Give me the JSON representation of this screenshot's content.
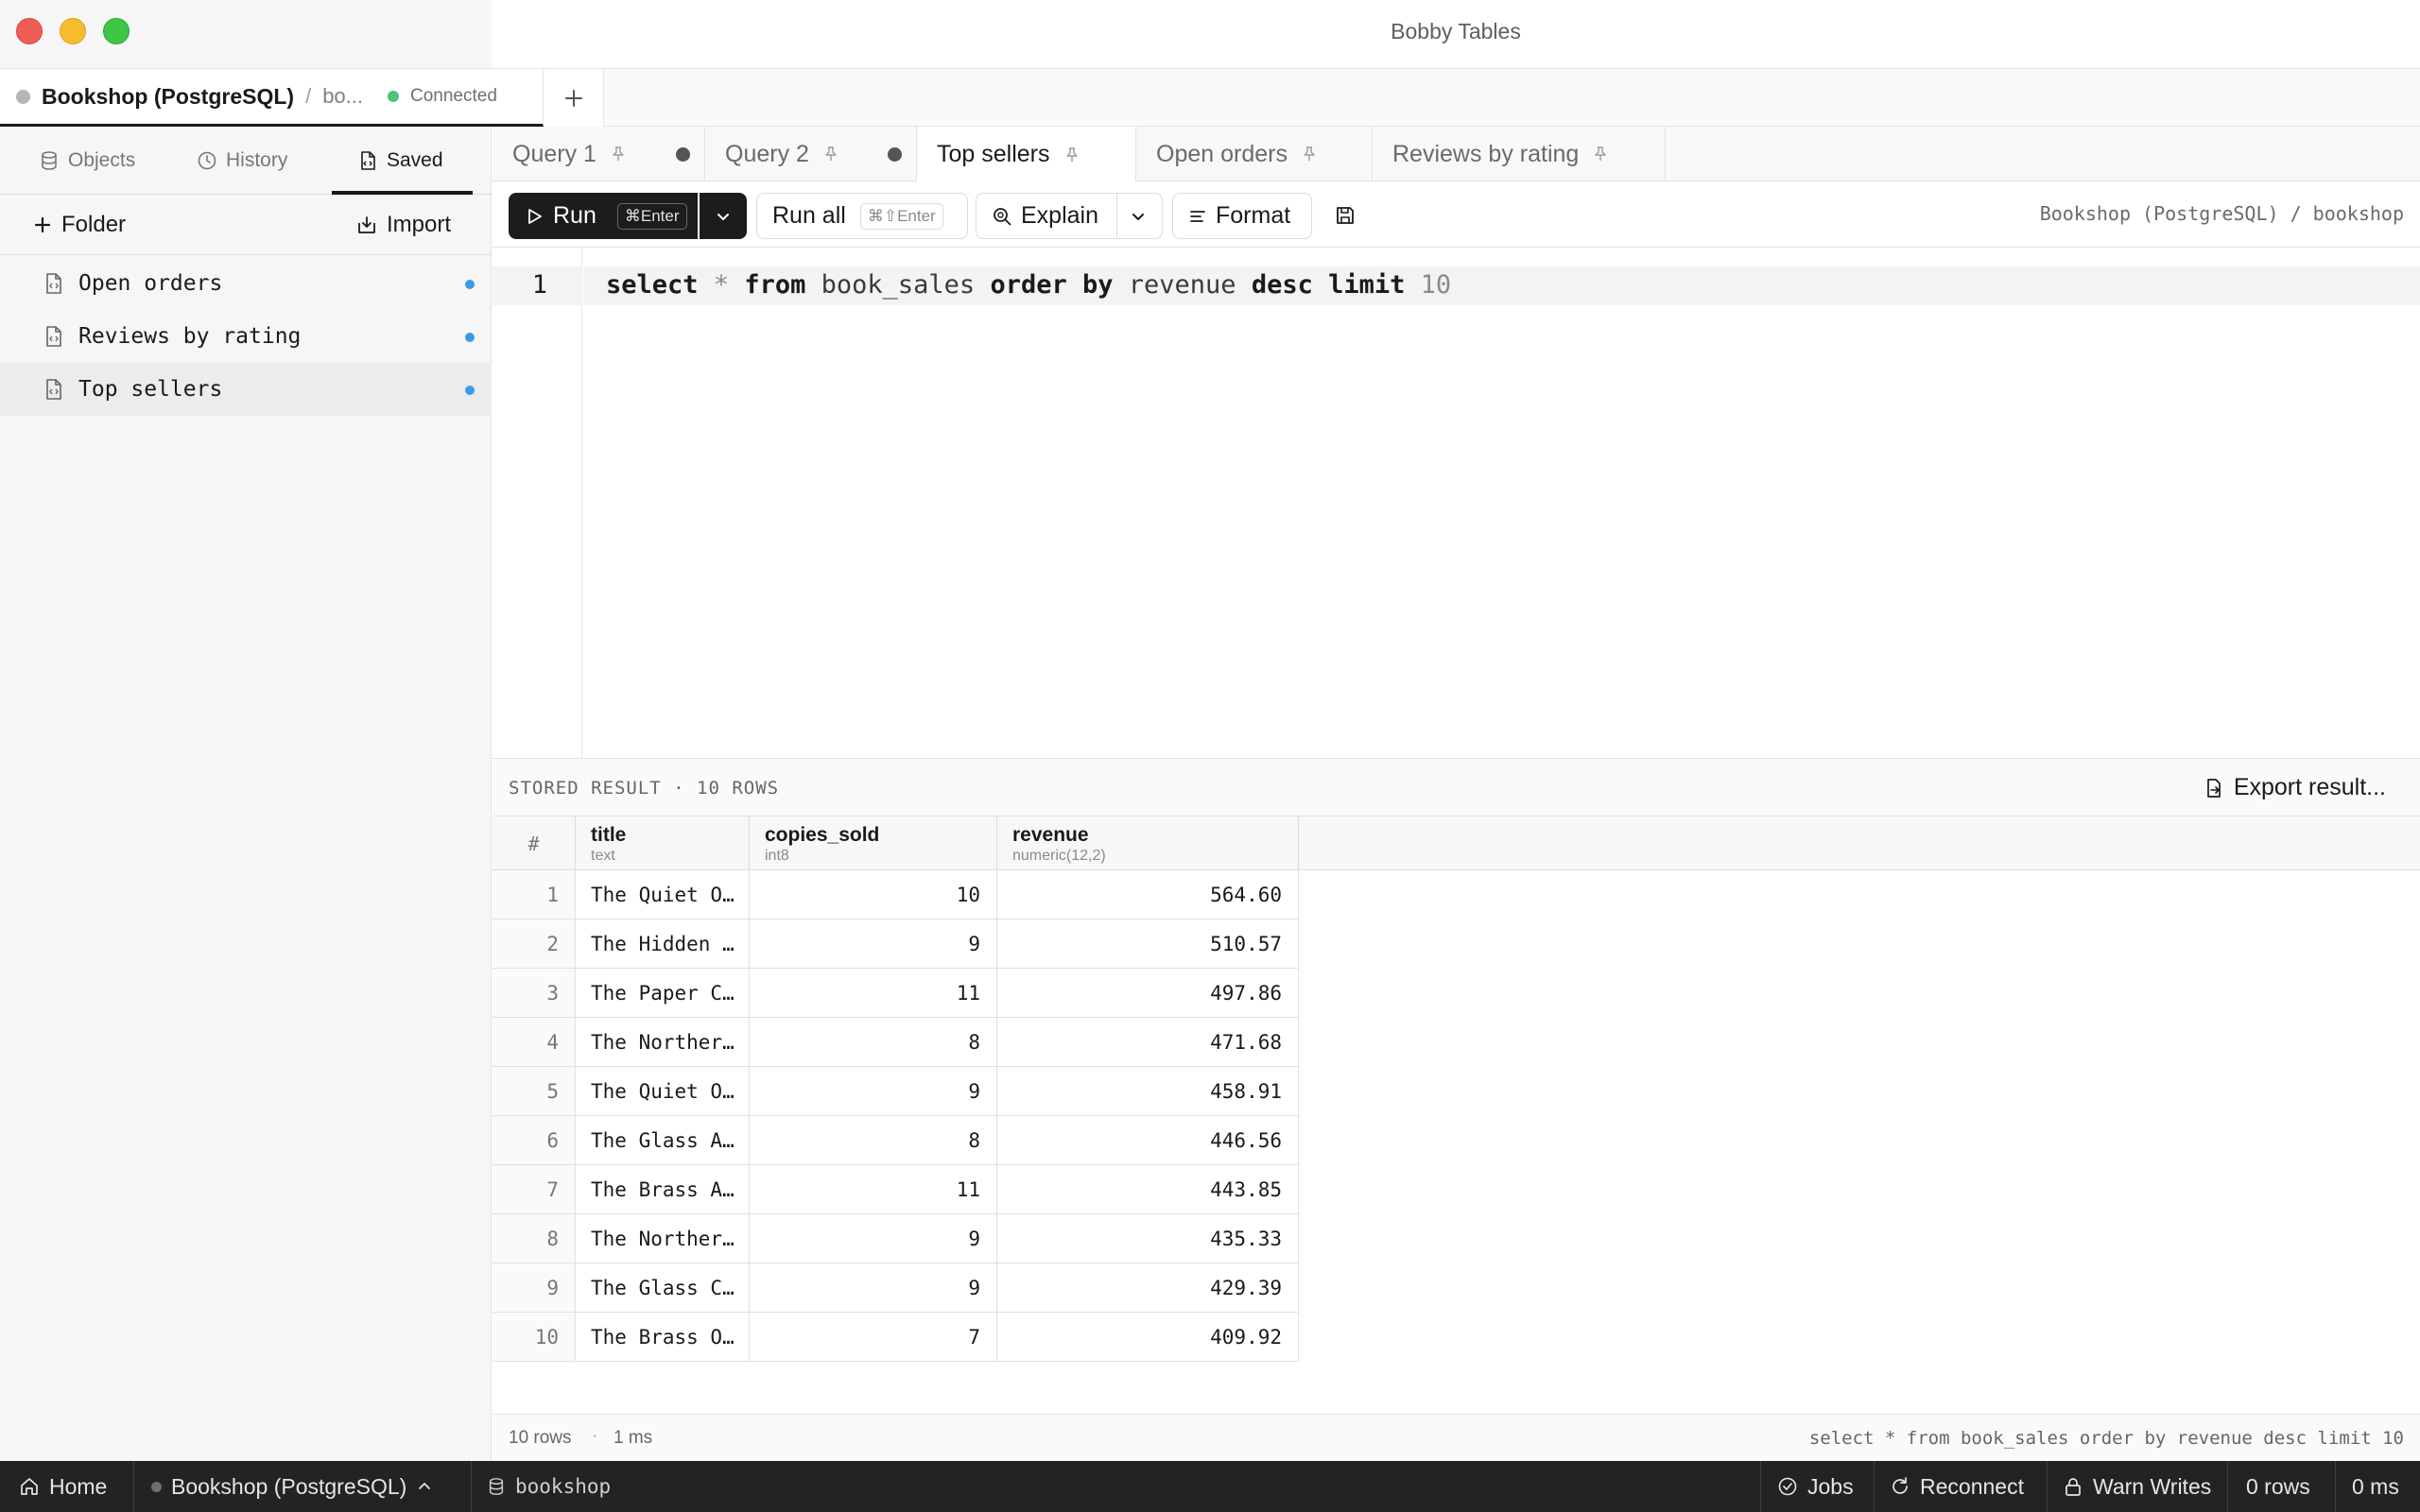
{
  "window": {
    "title": "Bobby Tables"
  },
  "connection_tab": {
    "name": "Bookshop (PostgreSQL)",
    "separator": "/",
    "database": "bo...",
    "status": "Connected"
  },
  "sidebar": {
    "tabs": [
      {
        "label": "Objects",
        "icon": "database-icon"
      },
      {
        "label": "History",
        "icon": "clock-icon"
      },
      {
        "label": "Saved",
        "icon": "saved-file-icon",
        "active": true
      }
    ],
    "folder_label": "Folder",
    "import_label": "Import",
    "saved_items": [
      {
        "label": "Open orders"
      },
      {
        "label": "Reviews by rating"
      },
      {
        "label": "Top sellers",
        "selected": true
      }
    ]
  },
  "query_tabs": [
    {
      "label": "Query 1",
      "dirty": true
    },
    {
      "label": "Query 2",
      "dirty": true
    },
    {
      "label": "Top sellers",
      "active": true
    },
    {
      "label": "Open orders"
    },
    {
      "label": "Reviews by rating"
    }
  ],
  "toolbar": {
    "run_label": "Run",
    "run_shortcut": "⌘Enter",
    "run_all_label": "Run all",
    "run_all_shortcut": "⌘⇧Enter",
    "explain_label": "Explain",
    "format_label": "Format",
    "path": "Bookshop (PostgreSQL) / bookshop"
  },
  "editor": {
    "line_number": "1",
    "tokens": [
      "select",
      " ",
      "*",
      " ",
      "from",
      " book_sales ",
      "order",
      " ",
      "by",
      " revenue ",
      "desc",
      " ",
      "limit",
      " ",
      "10"
    ]
  },
  "result": {
    "title": "STORED RESULT · 10 ROWS",
    "export_label": "Export result...",
    "row_number_header": "#",
    "columns": [
      {
        "name": "title",
        "type": "text"
      },
      {
        "name": "copies_sold",
        "type": "int8"
      },
      {
        "name": "revenue",
        "type": "numeric(12,2)"
      }
    ],
    "rows": [
      [
        "1",
        "The Quiet O…",
        "10",
        "564.60"
      ],
      [
        "2",
        "The Hidden …",
        "9",
        "510.57"
      ],
      [
        "3",
        "The Paper C…",
        "11",
        "497.86"
      ],
      [
        "4",
        "The Norther…",
        "8",
        "471.68"
      ],
      [
        "5",
        "The Quiet O…",
        "9",
        "458.91"
      ],
      [
        "6",
        "The Glass A…",
        "8",
        "446.56"
      ],
      [
        "7",
        "The Brass A…",
        "11",
        "443.85"
      ],
      [
        "8",
        "The Norther…",
        "9",
        "435.33"
      ],
      [
        "9",
        "The Glass C…",
        "9",
        "429.39"
      ],
      [
        "10",
        "The Brass O…",
        "7",
        "409.92"
      ]
    ],
    "status": {
      "rows": "10 rows",
      "separator": "·",
      "time": "1 ms",
      "query": "select * from book_sales order by revenue desc limit 10"
    }
  },
  "bottombar": {
    "home_label": "Home",
    "connection_label": "Bookshop (PostgreSQL)",
    "database_label": "bookshop",
    "jobs_label": "Jobs",
    "reconnect_label": "Reconnect",
    "warn_writes_label": "Warn Writes",
    "rows_label": "0 rows",
    "ms_label": "0 ms"
  },
  "colors": {
    "accent_dot": "#3b9be6",
    "connected": "#4ec37c",
    "bottombar_bg": "#232323"
  }
}
